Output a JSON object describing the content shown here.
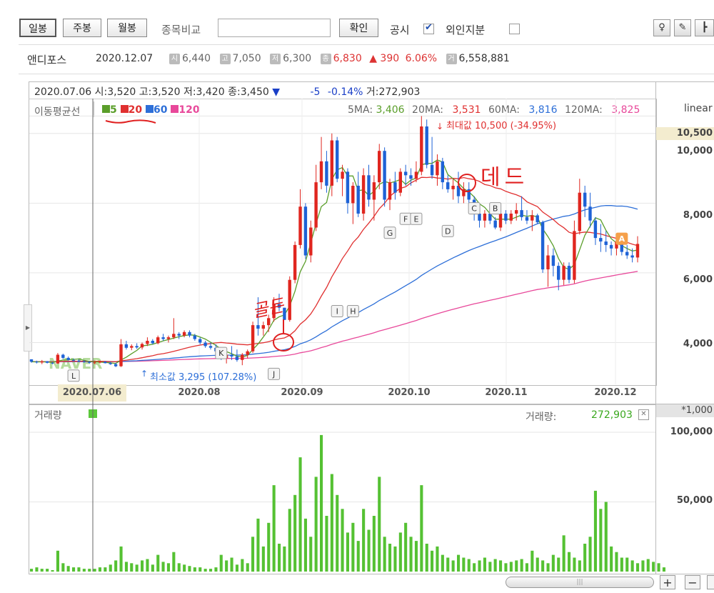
{
  "toolbar": {
    "period_buttons": [
      "일봉",
      "주봉",
      "월봉"
    ],
    "compare_label": "종목비교",
    "compare_placeholder": "",
    "confirm_button": "확인",
    "disclosure_label": "공시",
    "foreign_label": "외인지분",
    "icons": [
      "bulb-icon",
      "pen-icon",
      "cursor-icon"
    ]
  },
  "quote": {
    "name": "앤디포스",
    "date": "2020.12.07",
    "open_badge": "시",
    "open": "6,440",
    "high_badge": "고",
    "high": "7,050",
    "low_badge": "저",
    "low": "6,300",
    "close_badge": "종",
    "close": "6,830",
    "change_arrow": "▲",
    "change": "390",
    "change_pct": "6.06%",
    "volume_badge": "거",
    "volume": "6,558,881"
  },
  "cursor_info": {
    "date": "2020.07.06",
    "open_label": "시:",
    "open": "3,520",
    "high_label": "고:",
    "high": "3,520",
    "low_label": "저:",
    "low": "3,420",
    "close_label": "종:",
    "close": "3,450",
    "arrow": "▼",
    "change": "-5",
    "change_pct": "-0.14%",
    "volume_label": "거:",
    "volume": "272,903",
    "x_highlight": "2020.07.06"
  },
  "ma_legend": {
    "label": "이동평균선",
    "items": [
      {
        "period": "5",
        "color": "#5a9e2a"
      },
      {
        "period": "20",
        "color": "#e03030"
      },
      {
        "period": "60",
        "color": "#2d6fd8"
      },
      {
        "period": "120",
        "color": "#e8489a"
      }
    ],
    "values": [
      {
        "label": "5MA:",
        "value": "3,406",
        "color": "#5a9e2a"
      },
      {
        "label": "20MA:",
        "value": "3,531",
        "color": "#e03030"
      },
      {
        "label": "60MA:",
        "value": "3,816",
        "color": "#2d6fd8"
      },
      {
        "label": "120MA:",
        "value": "3,825",
        "color": "#e8489a"
      }
    ]
  },
  "scale_label": "linear",
  "annotations": {
    "max": "최대값 10,500 (-34.95%)",
    "min": "최소값 3,295 (107.28%)",
    "handwritten_golden": "골든",
    "handwritten_dead": "데드",
    "watermark": "NAVER",
    "markers": [
      "L",
      "K",
      "J",
      "I",
      "H",
      "G",
      "F",
      "E",
      "D",
      "C",
      "B",
      "A"
    ]
  },
  "volume_panel": {
    "label": "거래량",
    "value_label": "거래량:",
    "value": "272,903",
    "scale_label": "*1,000",
    "y_ticks": [
      "100,000",
      "50,000"
    ]
  },
  "controls": {
    "zoom_in": "+",
    "zoom_out": "−"
  },
  "chart_data": {
    "type": "candlestick",
    "x_ticks": [
      "2020.08",
      "2020.09",
      "2020.10",
      "2020.11",
      "2020.12"
    ],
    "y_ticks": [
      "10,500",
      "10,000",
      "8,000",
      "6,000",
      "4,000"
    ],
    "ylim": [
      2800,
      11000
    ],
    "volume_ylim": [
      0,
      120000
    ],
    "candles": [
      [
        3520,
        3520,
        3420,
        3450
      ],
      [
        3450,
        3480,
        3400,
        3430
      ],
      [
        3430,
        3500,
        3380,
        3460
      ],
      [
        3460,
        3470,
        3400,
        3420
      ],
      [
        3420,
        3440,
        3380,
        3400
      ],
      [
        3400,
        3700,
        3390,
        3650
      ],
      [
        3650,
        3680,
        3520,
        3560
      ],
      [
        3560,
        3600,
        3480,
        3500
      ],
      [
        3500,
        3540,
        3460,
        3480
      ],
      [
        3480,
        3520,
        3440,
        3460
      ],
      [
        3460,
        3500,
        3420,
        3440
      ],
      [
        3440,
        3470,
        3400,
        3420
      ],
      [
        3420,
        3460,
        3380,
        3430
      ],
      [
        3430,
        3480,
        3400,
        3450
      ],
      [
        3450,
        3470,
        3400,
        3410
      ],
      [
        3410,
        3450,
        3360,
        3380
      ],
      [
        3380,
        3420,
        3295,
        3320
      ],
      [
        3320,
        4100,
        3300,
        3950
      ],
      [
        3950,
        4050,
        3800,
        3850
      ],
      [
        3850,
        3950,
        3780,
        3900
      ],
      [
        3900,
        3980,
        3820,
        3860
      ],
      [
        3860,
        4000,
        3800,
        3960
      ],
      [
        3960,
        4150,
        3900,
        4050
      ],
      [
        4050,
        4100,
        3950,
        3980
      ],
      [
        3980,
        4200,
        3950,
        4150
      ],
      [
        4150,
        4250,
        4050,
        4100
      ],
      [
        4100,
        4200,
        4000,
        4150
      ],
      [
        4150,
        4700,
        4100,
        4250
      ],
      [
        4250,
        4300,
        4100,
        4200
      ],
      [
        4200,
        4350,
        4150,
        4300
      ],
      [
        4300,
        4350,
        4150,
        4200
      ],
      [
        4200,
        4250,
        4050,
        4100
      ],
      [
        4100,
        4150,
        3950,
        4000
      ],
      [
        4000,
        4050,
        3850,
        3900
      ],
      [
        3900,
        4000,
        3800,
        3850
      ],
      [
        3850,
        3950,
        3700,
        3750
      ],
      [
        3750,
        3800,
        3500,
        3550
      ],
      [
        3550,
        3700,
        3400,
        3650
      ],
      [
        3650,
        3900,
        3500,
        3600
      ],
      [
        3600,
        3800,
        3450,
        3500
      ],
      [
        3500,
        3700,
        3350,
        3650
      ],
      [
        3650,
        3800,
        3550,
        3750
      ],
      [
        3750,
        4600,
        3700,
        4500
      ],
      [
        4500,
        5300,
        4200,
        4400
      ],
      [
        4400,
        4600,
        4200,
        4500
      ],
      [
        4500,
        4800,
        4300,
        4700
      ],
      [
        4700,
        5300,
        4600,
        5100
      ],
      [
        5100,
        5400,
        4900,
        5000
      ],
      [
        5000,
        5000,
        4650,
        4650
      ],
      [
        4650,
        5900,
        4600,
        5800
      ],
      [
        5800,
        6900,
        5700,
        6800
      ],
      [
        6800,
        8400,
        6700,
        7900
      ],
      [
        7900,
        8000,
        6400,
        6500
      ],
      [
        6500,
        7500,
        6300,
        7300
      ],
      [
        7300,
        9100,
        7200,
        8600
      ],
      [
        8600,
        9900,
        8400,
        9200
      ],
      [
        9200,
        9500,
        8300,
        8500
      ],
      [
        8500,
        10000,
        8200,
        9800
      ],
      [
        9800,
        9900,
        8600,
        8700
      ],
      [
        8700,
        9100,
        8200,
        8900
      ],
      [
        8900,
        9000,
        7700,
        8000
      ],
      [
        8000,
        8600,
        7400,
        8500
      ],
      [
        8500,
        8900,
        7600,
        7700
      ],
      [
        7700,
        9000,
        7500,
        8800
      ],
      [
        8800,
        9100,
        7900,
        8100
      ],
      [
        8100,
        8800,
        7500,
        8600
      ],
      [
        8600,
        9700,
        8400,
        9500
      ],
      [
        9500,
        9600,
        7900,
        8100
      ],
      [
        8100,
        8700,
        7800,
        8600
      ],
      [
        8600,
        8900,
        8100,
        8300
      ],
      [
        8300,
        9000,
        8200,
        8900
      ],
      [
        8900,
        9100,
        8500,
        8800
      ],
      [
        8800,
        9000,
        8500,
        8700
      ],
      [
        8700,
        9200,
        8600,
        8900
      ],
      [
        8900,
        10500,
        8800,
        10200
      ],
      [
        10200,
        10400,
        9000,
        9100
      ],
      [
        9100,
        9900,
        8700,
        8800
      ],
      [
        8800,
        9400,
        8500,
        9200
      ],
      [
        9200,
        9300,
        8400,
        8600
      ],
      [
        8600,
        8800,
        8300,
        8400
      ],
      [
        8400,
        8700,
        8100,
        8500
      ],
      [
        8500,
        8900,
        8000,
        8200
      ],
      [
        8200,
        8600,
        8000,
        8400
      ],
      [
        8400,
        8600,
        7900,
        8100
      ],
      [
        8100,
        8200,
        7500,
        7700
      ],
      [
        7700,
        7900,
        7300,
        7500
      ],
      [
        7500,
        7800,
        7300,
        7700
      ],
      [
        7700,
        7800,
        7400,
        7500
      ],
      [
        7500,
        7600,
        7250,
        7300
      ],
      [
        7300,
        7900,
        7200,
        7700
      ],
      [
        7700,
        7800,
        7400,
        7500
      ],
      [
        7500,
        7800,
        7400,
        7700
      ],
      [
        7700,
        8000,
        7500,
        7800
      ],
      [
        7800,
        8200,
        7500,
        7600
      ],
      [
        7600,
        7800,
        7400,
        7500
      ],
      [
        7500,
        7800,
        7200,
        7650
      ],
      [
        7650,
        7700,
        7400,
        7450
      ],
      [
        7450,
        7500,
        6000,
        6100
      ],
      [
        6100,
        6800,
        5600,
        6500
      ],
      [
        6500,
        6700,
        5900,
        6200
      ],
      [
        6200,
        6300,
        5500,
        5800
      ],
      [
        5800,
        6300,
        5650,
        6200
      ],
      [
        6200,
        6300,
        5700,
        5800
      ],
      [
        5800,
        7500,
        5700,
        7200
      ],
      [
        7200,
        8700,
        7100,
        8300
      ],
      [
        8300,
        8500,
        7600,
        7900
      ],
      [
        7900,
        8300,
        7300,
        7500
      ],
      [
        7500,
        7600,
        6800,
        7000
      ],
      [
        7000,
        7400,
        6600,
        6900
      ],
      [
        6900,
        7200,
        6600,
        6800
      ],
      [
        6800,
        6900,
        6500,
        6700
      ],
      [
        6700,
        7000,
        6500,
        6900
      ],
      [
        6900,
        7000,
        6500,
        6600
      ],
      [
        6600,
        6800,
        6400,
        6500
      ],
      [
        6500,
        6700,
        6300,
        6440
      ],
      [
        6440,
        7050,
        6300,
        6830
      ]
    ],
    "volume": [
      2,
      3,
      2,
      2,
      1,
      15,
      6,
      4,
      3,
      3,
      2,
      2,
      2,
      3,
      3,
      5,
      8,
      18,
      7,
      6,
      5,
      8,
      9,
      5,
      12,
      7,
      6,
      14,
      6,
      5,
      4,
      3,
      3,
      2,
      2,
      3,
      12,
      8,
      10,
      5,
      9,
      6,
      25,
      38,
      18,
      35,
      62,
      20,
      18,
      45,
      55,
      82,
      38,
      25,
      68,
      98,
      40,
      70,
      55,
      45,
      28,
      35,
      22,
      45,
      30,
      40,
      68,
      25,
      20,
      18,
      28,
      35,
      25,
      22,
      62,
      20,
      15,
      18,
      12,
      10,
      8,
      12,
      10,
      9,
      6,
      8,
      10,
      7,
      9,
      8,
      6,
      7,
      8,
      9,
      6,
      15,
      10,
      8,
      6,
      12,
      10,
      26,
      14,
      10,
      8,
      20,
      25,
      58,
      45,
      50,
      18,
      14,
      10,
      10,
      8,
      6,
      8,
      9,
      7,
      6,
      3
    ]
  }
}
